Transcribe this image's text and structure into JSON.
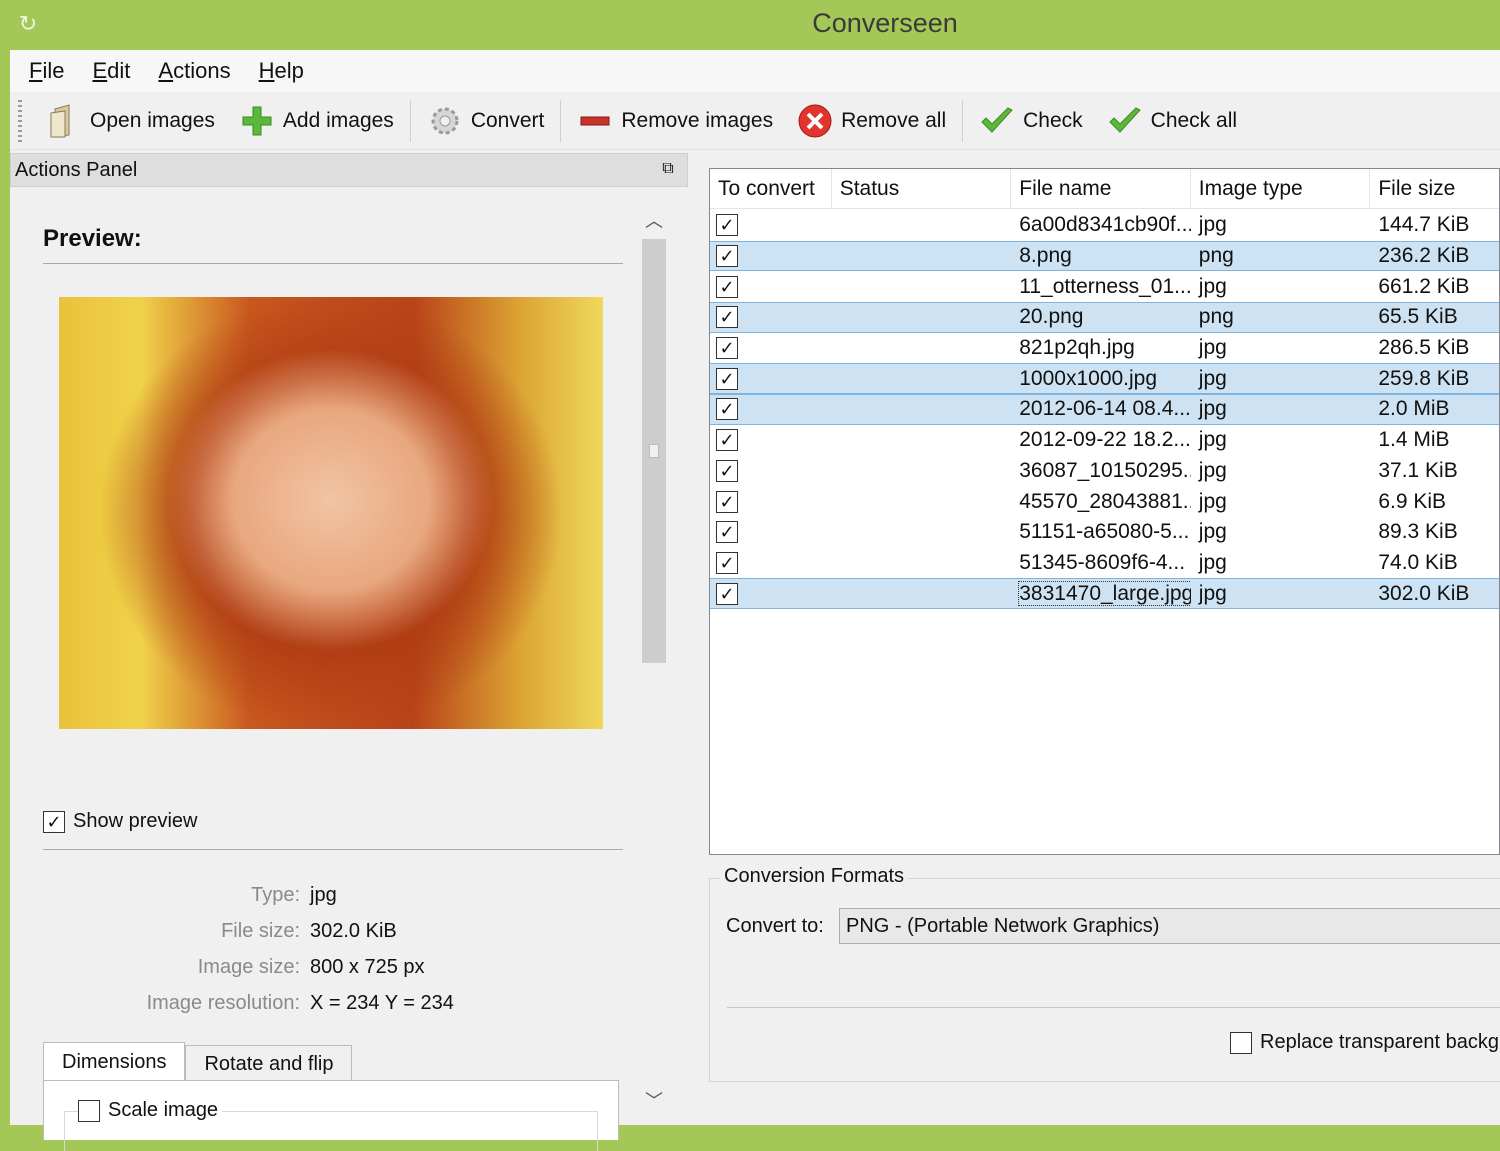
{
  "window": {
    "title": "Converseen"
  },
  "menu": [
    "File",
    "Edit",
    "Actions",
    "Help"
  ],
  "toolbar": {
    "open_images": "Open images",
    "add_images": "Add images",
    "convert": "Convert",
    "remove_images": "Remove images",
    "remove_all": "Remove all",
    "check": "Check",
    "check_all": "Check all"
  },
  "actions_panel": {
    "title": "Actions Panel",
    "preview_title": "Preview:",
    "show_preview_label": "Show preview",
    "show_preview_checked": true,
    "info": {
      "type_label": "Type:",
      "type_value": "jpg",
      "file_size_label": "File size:",
      "file_size_value": "302.0 KiB",
      "image_size_label": "Image size:",
      "image_size_value": "800 x 725 px",
      "resolution_label": "Image resolution:",
      "resolution_value": "X = 234 Y = 234"
    },
    "tabs": [
      "Dimensions",
      "Rotate and flip"
    ],
    "active_tab": "Dimensions",
    "scale_image_label": "Scale image",
    "scale_image_checked": false
  },
  "file_list": {
    "columns": [
      "To convert",
      "Status",
      "File name",
      "Image type",
      "File size"
    ],
    "rows": [
      {
        "checked": true,
        "status": "",
        "name": "6a00d8341cb90f...",
        "type": "jpg",
        "size": "144.7 KiB",
        "selected": false
      },
      {
        "checked": true,
        "status": "",
        "name": "8.png",
        "type": "png",
        "size": "236.2 KiB",
        "selected": true
      },
      {
        "checked": true,
        "status": "",
        "name": "11_otterness_01...",
        "type": "jpg",
        "size": "661.2 KiB",
        "selected": false
      },
      {
        "checked": true,
        "status": "",
        "name": "20.png",
        "type": "png",
        "size": "65.5 KiB",
        "selected": true
      },
      {
        "checked": true,
        "status": "",
        "name": "821p2qh.jpg",
        "type": "jpg",
        "size": "286.5 KiB",
        "selected": false
      },
      {
        "checked": true,
        "status": "",
        "name": "1000x1000.jpg",
        "type": "jpg",
        "size": "259.8 KiB",
        "selected": true
      },
      {
        "checked": true,
        "status": "",
        "name": "2012-06-14 08.4...",
        "type": "jpg",
        "size": "2.0 MiB",
        "selected": true
      },
      {
        "checked": true,
        "status": "",
        "name": "2012-09-22 18.2...",
        "type": "jpg",
        "size": "1.4 MiB",
        "selected": false
      },
      {
        "checked": true,
        "status": "",
        "name": "36087_10150295...",
        "type": "jpg",
        "size": "37.1 KiB",
        "selected": false
      },
      {
        "checked": true,
        "status": "",
        "name": "45570_28043881...",
        "type": "jpg",
        "size": "6.9 KiB",
        "selected": false
      },
      {
        "checked": true,
        "status": "",
        "name": "51151-a65080-5...",
        "type": "jpg",
        "size": "89.3 KiB",
        "selected": false
      },
      {
        "checked": true,
        "status": "",
        "name": "51345-8609f6-4...",
        "type": "jpg",
        "size": "74.0 KiB",
        "selected": false
      },
      {
        "checked": true,
        "status": "",
        "name": "3831470_large.jpg",
        "type": "jpg",
        "size": "302.0 KiB",
        "selected": true,
        "focused": true
      }
    ]
  },
  "conversion": {
    "group_title": "Conversion Formats",
    "convert_to_label": "Convert to:",
    "convert_to_value": "PNG - (Portable Network Graphics)",
    "replace_bg_label": "Replace transparent backgr",
    "replace_bg_checked": false
  },
  "colors": {
    "titlebar": "#a4c857",
    "selection": "#cde3f3",
    "selection_border": "#7eb4e0"
  }
}
